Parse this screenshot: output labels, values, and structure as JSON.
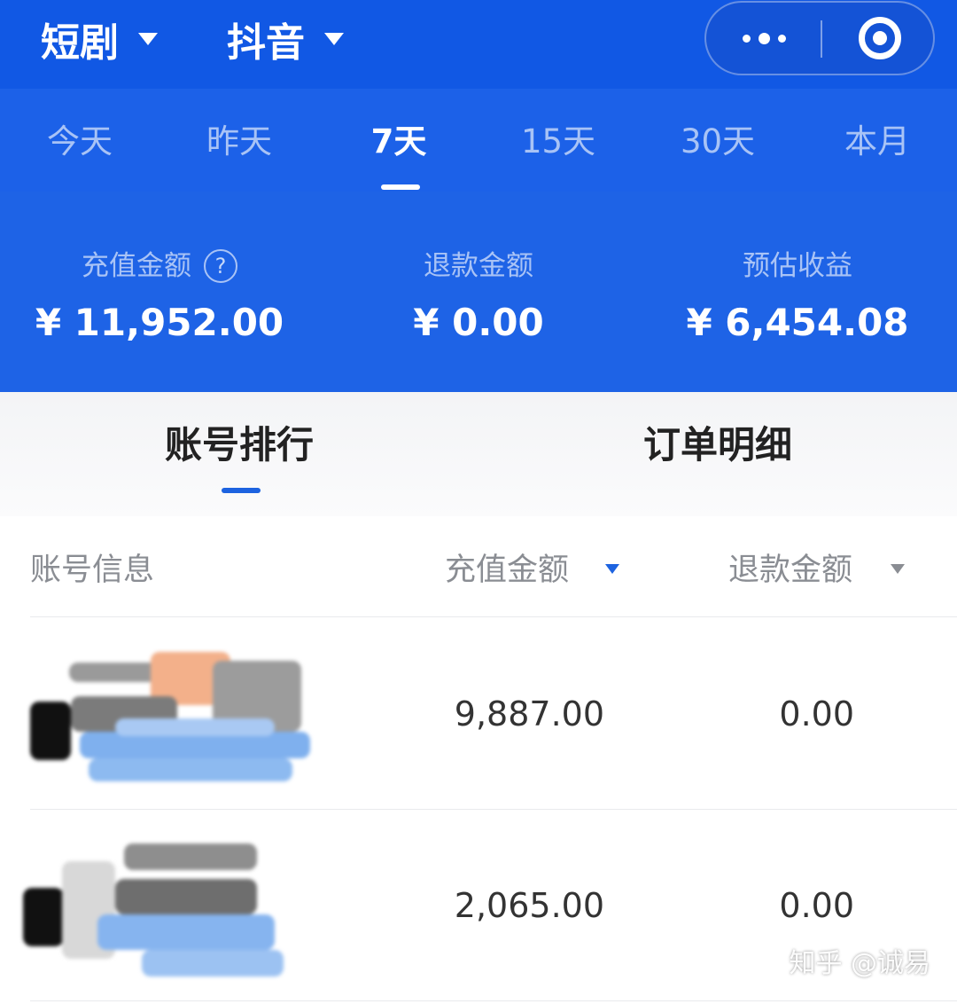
{
  "header": {
    "genre_selector": "短剧",
    "platform_selector": "抖音",
    "more_icon": "more-dots-icon",
    "close_icon": "target-circle-icon"
  },
  "period_tabs": [
    {
      "label": "今天",
      "active": false
    },
    {
      "label": "昨天",
      "active": false
    },
    {
      "label": "7天",
      "active": true
    },
    {
      "label": "15天",
      "active": false
    },
    {
      "label": "30天",
      "active": false
    },
    {
      "label": "本月",
      "active": false
    }
  ],
  "summary": {
    "recharge": {
      "label": "充值金额",
      "help": "?",
      "value": "¥ 11,952.00"
    },
    "refund": {
      "label": "退款金额",
      "value": "¥ 0.00"
    },
    "estimated_income": {
      "label": "预估收益",
      "value": "¥ 6,454.08"
    }
  },
  "content_tabs": {
    "account_ranking": "账号排行",
    "order_details": "订单明细",
    "active": "账号排行"
  },
  "table": {
    "columns": {
      "account_info": "账号信息",
      "recharge_amount": "充值金额",
      "refund_amount": "退款金额"
    },
    "rows": [
      {
        "account": "",
        "recharge": "9,887.00",
        "refund": "0.00"
      },
      {
        "account": "",
        "recharge": "2,065.00",
        "refund": "0.00"
      }
    ]
  },
  "watermark": "知乎 @诚易",
  "colors": {
    "brand_blue": "#1e63e6",
    "topbar_blue": "#1158e4",
    "active_indicator": "#1d63e0",
    "muted_text": "#8a8d93"
  }
}
